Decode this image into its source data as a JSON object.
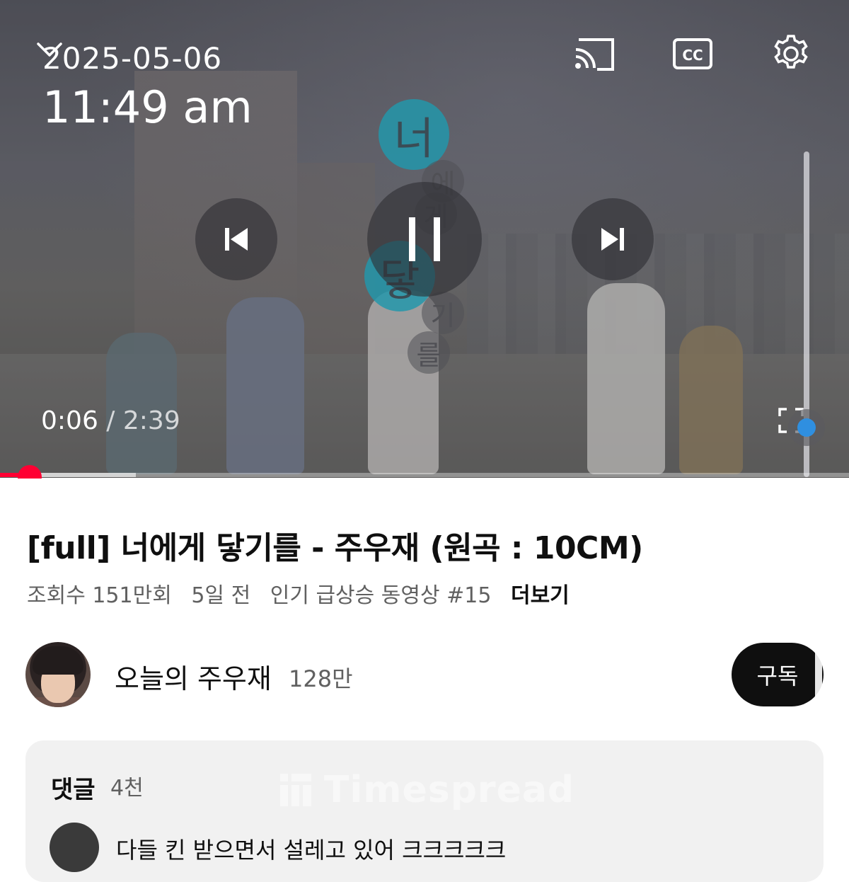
{
  "player": {
    "date": "2025-05-06",
    "time": "11:49 am",
    "current_time": "0:06",
    "separator": "/",
    "duration": "2:39",
    "progress_fraction": 0.035,
    "buffered_fraction": 0.16,
    "lyrics": [
      "너",
      "에",
      "게",
      "닿",
      "기",
      "를"
    ],
    "icons": {
      "collapse": "chevron-down-icon",
      "cast": "cast-icon",
      "captions": "cc-icon",
      "settings": "gear-icon",
      "previous": "skip-previous-icon",
      "pause": "pause-icon",
      "next": "skip-next-icon",
      "fullscreen": "fullscreen-icon"
    },
    "accent_color": "#ff0033"
  },
  "video": {
    "title": "[full] 너에게 닿기를 - 주우재 (원곡 : 10CM)",
    "views": "조회수 151만회",
    "age": "5일 전",
    "trending": "인기 급상승 동영상 #15",
    "more": "더보기"
  },
  "channel": {
    "name": "오늘의 주우재",
    "subscribers": "128만",
    "subscribe_label": "구독"
  },
  "comments": {
    "label": "댓글",
    "count": "4천",
    "watermark": "Timespread",
    "first_comment": "다들 킨 받으면서 설레고 있어 크크크크크"
  }
}
